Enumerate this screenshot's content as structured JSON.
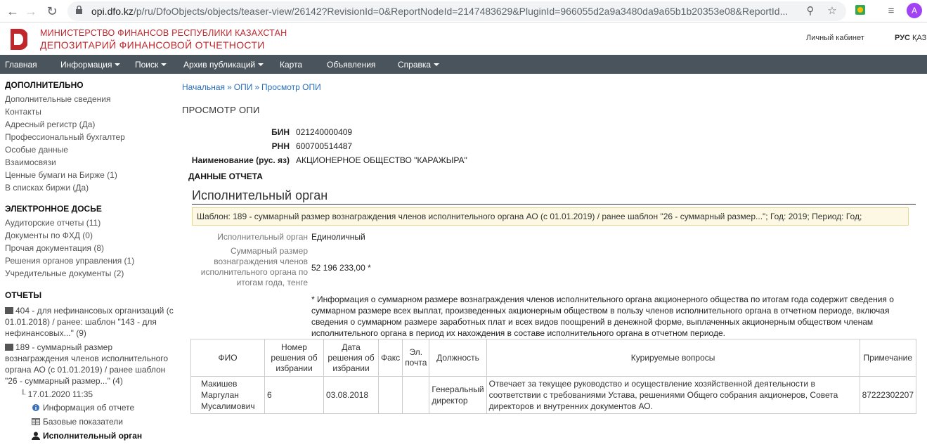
{
  "browser": {
    "url_host": "opi.dfo.kz",
    "url_path": "/p/ru/DfoObjects/objects/teaser-view/26142?RevisionId=0&ReportNodeId=2147483629&PluginId=966055d2a9a3480da9a65b1b20353e08&ReportId...",
    "avatar_letter": "A"
  },
  "header": {
    "org_line1": "МИНИСТЕРСТВО ФИНАНСОВ РЕСПУБЛИКИ КАЗАХСТАН",
    "org_line2": "ДЕПОЗИТАРИЙ ФИНАНСОВОЙ ОТЧЕТНОСТИ",
    "cabinet": "Личный кабинет",
    "lang_active": "РУС",
    "lang_other": "ҚАЗ",
    "brand_color": "#c0272d"
  },
  "nav": {
    "items": [
      {
        "label": "Главная"
      },
      {
        "label": "Информация"
      },
      {
        "label": "Поиск"
      },
      {
        "label": "Архив публикаций"
      },
      {
        "label": "Карта"
      },
      {
        "label": "Объявления"
      },
      {
        "label": "Справка"
      }
    ]
  },
  "sidebar": {
    "section1": {
      "title": "ДОПОЛНИТЕЛЬНО",
      "links": [
        "Дополнительные сведения",
        "Контакты",
        "Адресный регистр (Да)",
        "Профессиональный бухгалтер",
        "Особые данные",
        "Взаимосвязи",
        "Ценные бумаги на Бирже (1)",
        "В списках биржи (Да)"
      ]
    },
    "section2": {
      "title": "ЭЛЕКТРОННОЕ ДОСЬЕ",
      "links": [
        "Аудиторские отчеты (11)",
        "Документы по ФХД (0)",
        "Прочая документация (8)",
        "Решения органов управления (1)",
        "Учредительные документы (2)"
      ]
    },
    "section3": {
      "title": "ОТЧЕТЫ",
      "report1": "404 - для нефинансовых организаций (с 01.01.2018) / ранее: шаблон \"143 - для нефинансовых...\" (9)",
      "report2": "189 - суммарный размер вознаграждения членов исполнительного органа АО (с 01.01.2019) / ранее шаблон \"26 - суммарный размер...\" (4)",
      "date_node": "17.01.2020 11:35",
      "children": [
        "Информация об отчете",
        "Базовые показатели",
        "Исполнительный орган"
      ]
    }
  },
  "breadcrumb": [
    "Начальная",
    "ОПИ",
    "Просмотр ОПИ"
  ],
  "page_title": "ПРОСМОТР ОПИ",
  "company": {
    "bin_label": "БИН",
    "bin": "021240000409",
    "rnn_label": "РНН",
    "rnn": "600700514487",
    "name_label": "Наименование (рус. яз)",
    "name": "АКЦИОНЕРНОЕ ОБЩЕСТВО \"КАРАЖЫРА\""
  },
  "report": {
    "section_title": "ДАННЫЕ ОТЧЕТА",
    "subsection_title": "Исполнительный орган",
    "template_info": "Шаблон: 189 - суммарный размер вознаграждения членов исполнительного органа АО (с 01.01.2019) / ранее шаблон \"26 - суммарный размер...\"; Год: 2019; Период: Год;",
    "exec_body_label": "Исполнительный орган",
    "exec_body_value": "Единоличный",
    "total_label": "Суммарный размер вознаграждения членов исполнительного органа по итогам года, тенге",
    "total_value": "52 196 233,00 *",
    "note": "* Информация о суммарном размере вознаграждения членов исполнительного органа акционерного общества по итогам года содержит сведения о суммарном размере всех выплат, произведенных акционерным обществом в пользу членов исполнительного органа в отчетном периоде, включая сведения о суммарном размере заработных плат и всех видов поощрений в денежной форме, выплаченных акционерным обществом членам исполнительного органа в период их нахождения в составе исполнительного органа в отчетном периоде."
  },
  "table": {
    "headers": [
      "ФИО",
      "Номер решения об избрании",
      "Дата решения об избрании",
      "Факс",
      "Эл. почта",
      "Должность",
      "Курируемые вопросы",
      "Примечание"
    ],
    "rows": [
      [
        "Макишев Маргулан Мусалимович",
        "6",
        "03.08.2018",
        "",
        "",
        "Генеральный директор",
        "Отвечает за текущее руководство и осуществление хозяйственной деятельности в соответствии с требованиями Устава, решениями Общего собрания акционеров, Совета директоров и внутренних документов АО.",
        "87222302207"
      ]
    ]
  }
}
